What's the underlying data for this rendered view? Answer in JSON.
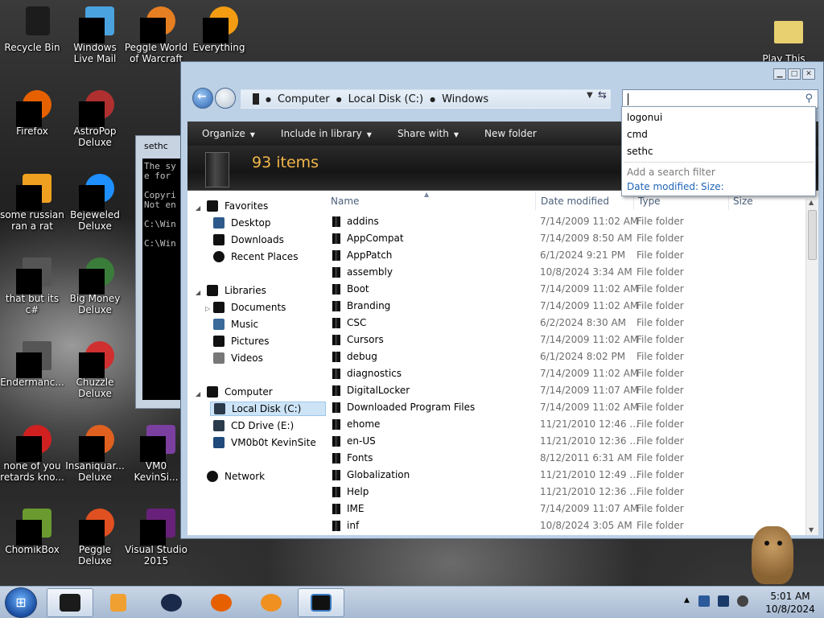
{
  "desktop": {
    "icons": [
      {
        "label": "Recycle Bin",
        "color": "#222222"
      },
      {
        "label": "Windows Live Mail",
        "color": "#4aa3df"
      },
      {
        "label": "Peggle World of Warcraft",
        "color": "#e67e22"
      },
      {
        "label": "Everything",
        "color": "#f39c12"
      },
      {
        "label": "Play This",
        "color": "#e8d070"
      },
      {
        "label": "Firefox",
        "color": "#e66000"
      },
      {
        "label": "AstroPop Deluxe",
        "color": "#b03030"
      },
      {
        "label": "some russian ran a rat",
        "color": "#f0a020"
      },
      {
        "label": "Bejeweled Deluxe",
        "color": "#1e90ff"
      },
      {
        "label": "that but its c#",
        "color": "#555555"
      },
      {
        "label": "Big Money Deluxe",
        "color": "#3a7d3a"
      },
      {
        "label": "Endermanc...",
        "color": "#555555"
      },
      {
        "label": "Chuzzle Deluxe",
        "color": "#d03030"
      },
      {
        "label": "none of you retards kno...",
        "color": "#d02020"
      },
      {
        "label": "Insaniquar... Deluxe",
        "color": "#e06020"
      },
      {
        "label": "VM0 KevinSi...",
        "color": "#7b3fa0"
      },
      {
        "label": "ChomikBox",
        "color": "#6a9a30"
      },
      {
        "label": "Peggle Deluxe",
        "color": "#e05020"
      },
      {
        "label": "Visual Studio 2015",
        "color": "#68217a"
      }
    ]
  },
  "cmd_window": {
    "title": "sethc",
    "lines": "The sy\ne for \n\nCopyri\nNot en\n\nC:\\Win\n\nC:\\Win"
  },
  "explorer": {
    "breadcrumb": [
      "Computer",
      "Local Disk (C:)",
      "Windows"
    ],
    "toolbar": {
      "organize": "Organize",
      "include_in_library": "Include in library",
      "share_with": "Share with",
      "new_folder": "New folder"
    },
    "details": {
      "count": "93 items"
    },
    "nav": {
      "favorites": "Favorites",
      "desktop": "Desktop",
      "downloads": "Downloads",
      "recent_places": "Recent Places",
      "libraries": "Libraries",
      "documents": "Documents",
      "music": "Music",
      "pictures": "Pictures",
      "videos": "Videos",
      "computer": "Computer",
      "local_disk": "Local Disk (C:)",
      "cd_drive": "CD Drive (E:)",
      "vm_site": "VM0b0t KevinSite",
      "network": "Network"
    },
    "columns": {
      "name": "Name",
      "date_modified": "Date modified",
      "type": "Type",
      "size": "Size"
    },
    "files": [
      {
        "name": "addins",
        "date": "7/14/2009 11:02 AM",
        "type": "File folder"
      },
      {
        "name": "AppCompat",
        "date": "7/14/2009 8:50 AM",
        "type": "File folder"
      },
      {
        "name": "AppPatch",
        "date": "6/1/2024 9:21 PM",
        "type": "File folder"
      },
      {
        "name": "assembly",
        "date": "10/8/2024 3:34 AM",
        "type": "File folder"
      },
      {
        "name": "Boot",
        "date": "7/14/2009 11:02 AM",
        "type": "File folder"
      },
      {
        "name": "Branding",
        "date": "7/14/2009 11:02 AM",
        "type": "File folder"
      },
      {
        "name": "CSC",
        "date": "6/2/2024 8:30 AM",
        "type": "File folder"
      },
      {
        "name": "Cursors",
        "date": "7/14/2009 11:02 AM",
        "type": "File folder"
      },
      {
        "name": "debug",
        "date": "6/1/2024 8:02 PM",
        "type": "File folder"
      },
      {
        "name": "diagnostics",
        "date": "7/14/2009 11:02 AM",
        "type": "File folder"
      },
      {
        "name": "DigitalLocker",
        "date": "7/14/2009 11:07 AM",
        "type": "File folder"
      },
      {
        "name": "Downloaded Program Files",
        "date": "7/14/2009 11:02 AM",
        "type": "File folder"
      },
      {
        "name": "ehome",
        "date": "11/21/2010 12:46 ...",
        "type": "File folder"
      },
      {
        "name": "en-US",
        "date": "11/21/2010 12:36 ...",
        "type": "File folder"
      },
      {
        "name": "Fonts",
        "date": "8/12/2011 6:31 AM",
        "type": "File folder"
      },
      {
        "name": "Globalization",
        "date": "11/21/2010 12:49 ...",
        "type": "File folder"
      },
      {
        "name": "Help",
        "date": "11/21/2010 12:36 ...",
        "type": "File folder"
      },
      {
        "name": "IME",
        "date": "7/14/2009 11:07 AM",
        "type": "File folder"
      },
      {
        "name": "inf",
        "date": "10/8/2024 3:05 AM",
        "type": "File folder"
      }
    ]
  },
  "search_dropdown": {
    "suggestions": [
      "logonui",
      "cmd",
      "sethc"
    ],
    "hint": "Add a search filter",
    "filters": [
      "Date modified:",
      "Size:"
    ]
  },
  "taskbar": {
    "clock_time": "5:01 AM",
    "clock_date": "10/8/2024"
  },
  "colors": {
    "accent_orange": "#f2b74a",
    "link_blue": "#1e64b8"
  }
}
